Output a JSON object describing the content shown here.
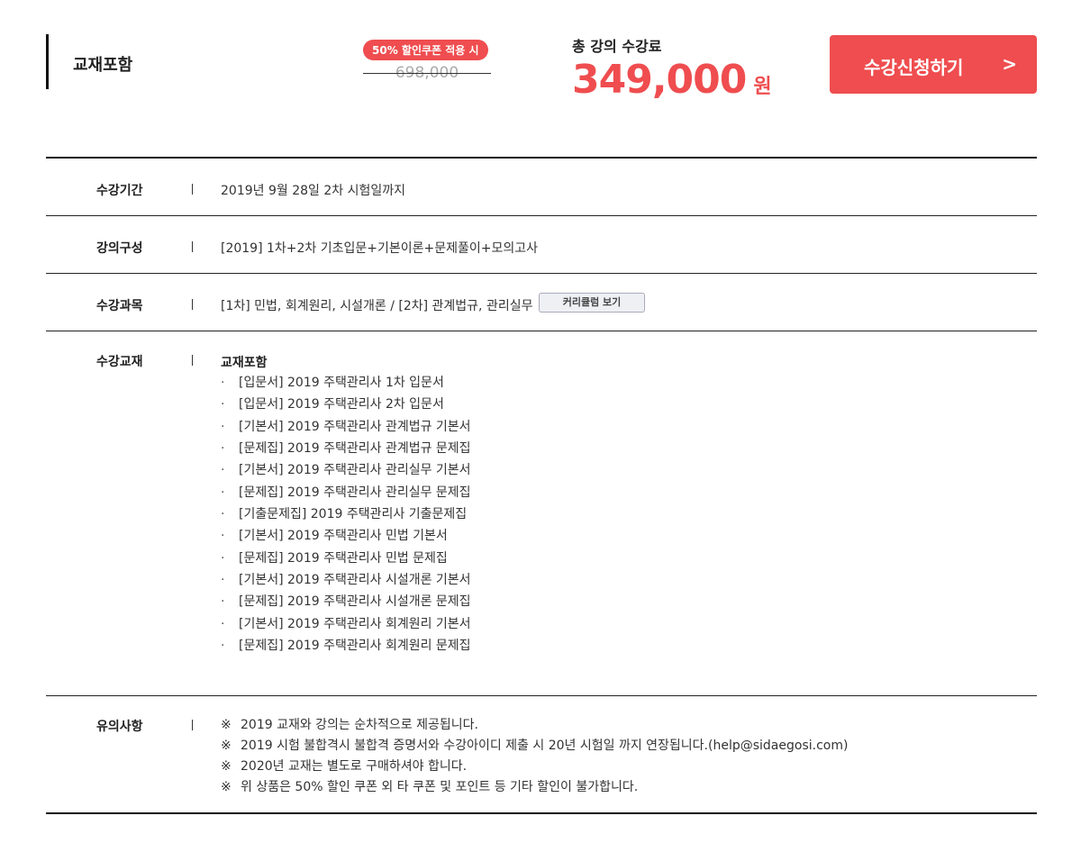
{
  "header": {
    "package_title": "교재포함",
    "coupon_badge": "50% 할인쿠폰 적용 시",
    "original_price": "698,000",
    "total_label": "총 강의 수강료",
    "total_price": "349,000",
    "currency": "원",
    "apply_button_label": "수강신청하기",
    "apply_button_icon": "chevron-right-icon",
    "accent_color": "#ef4d4f"
  },
  "info": {
    "period": {
      "label": "수강기간",
      "value": "2019년 9월 28일 2차 시험일까지"
    },
    "composition": {
      "label": "강의구성",
      "value": "[2019] 1차+2차 기초입문+기본이론+문제풀이+모의고사"
    },
    "subjects": {
      "label": "수강과목",
      "value": "[1차] 민법, 회계원리, 시설개론 / [2차] 관계법규, 관리실무",
      "button_label": "커리큘럼 보기"
    },
    "books": {
      "label": "수강교재",
      "heading": "교재포함",
      "bullet": "·",
      "items": [
        "[입문서] 2019 주택관리사 1차 입문서",
        "[입문서] 2019 주택관리사 2차 입문서",
        "[기본서] 2019 주택관리사 관계법규 기본서",
        "[문제집] 2019 주택관리사 관계법규 문제집",
        "[기본서] 2019 주택관리사 관리실무 기본서",
        "[문제집] 2019 주택관리사 관리실무 문제집",
        "[기출문제집] 2019 주택관리사 기출문제집",
        "[기본서] 2019 주택관리사 민법 기본서",
        "[문제집] 2019 주택관리사 민법 문제집",
        "[기본서] 2019 주택관리사 시설개론 기본서",
        "[문제집] 2019 주택관리사 시설개론 문제집",
        "[기본서] 2019 주택관리사 회계원리 기본서",
        "[문제집] 2019 주택관리사 회계원리 문제집"
      ]
    },
    "notes": {
      "label": "유의사항",
      "mark": "※",
      "items": [
        "2019 교재와 강의는 순차적으로 제공됩니다.",
        "2019 시험 불합격시 불합격 증명서와 수강아이디 제출 시 20년 시험일 까지 연장됩니다.(help@sidaegosi.com)",
        "2020년 교재는 별도로 구매하셔야 합니다.",
        "위 상품은 50% 할인 쿠폰 외 타 쿠폰 및 포인트 등 기타 할인이 불가합니다."
      ]
    }
  }
}
